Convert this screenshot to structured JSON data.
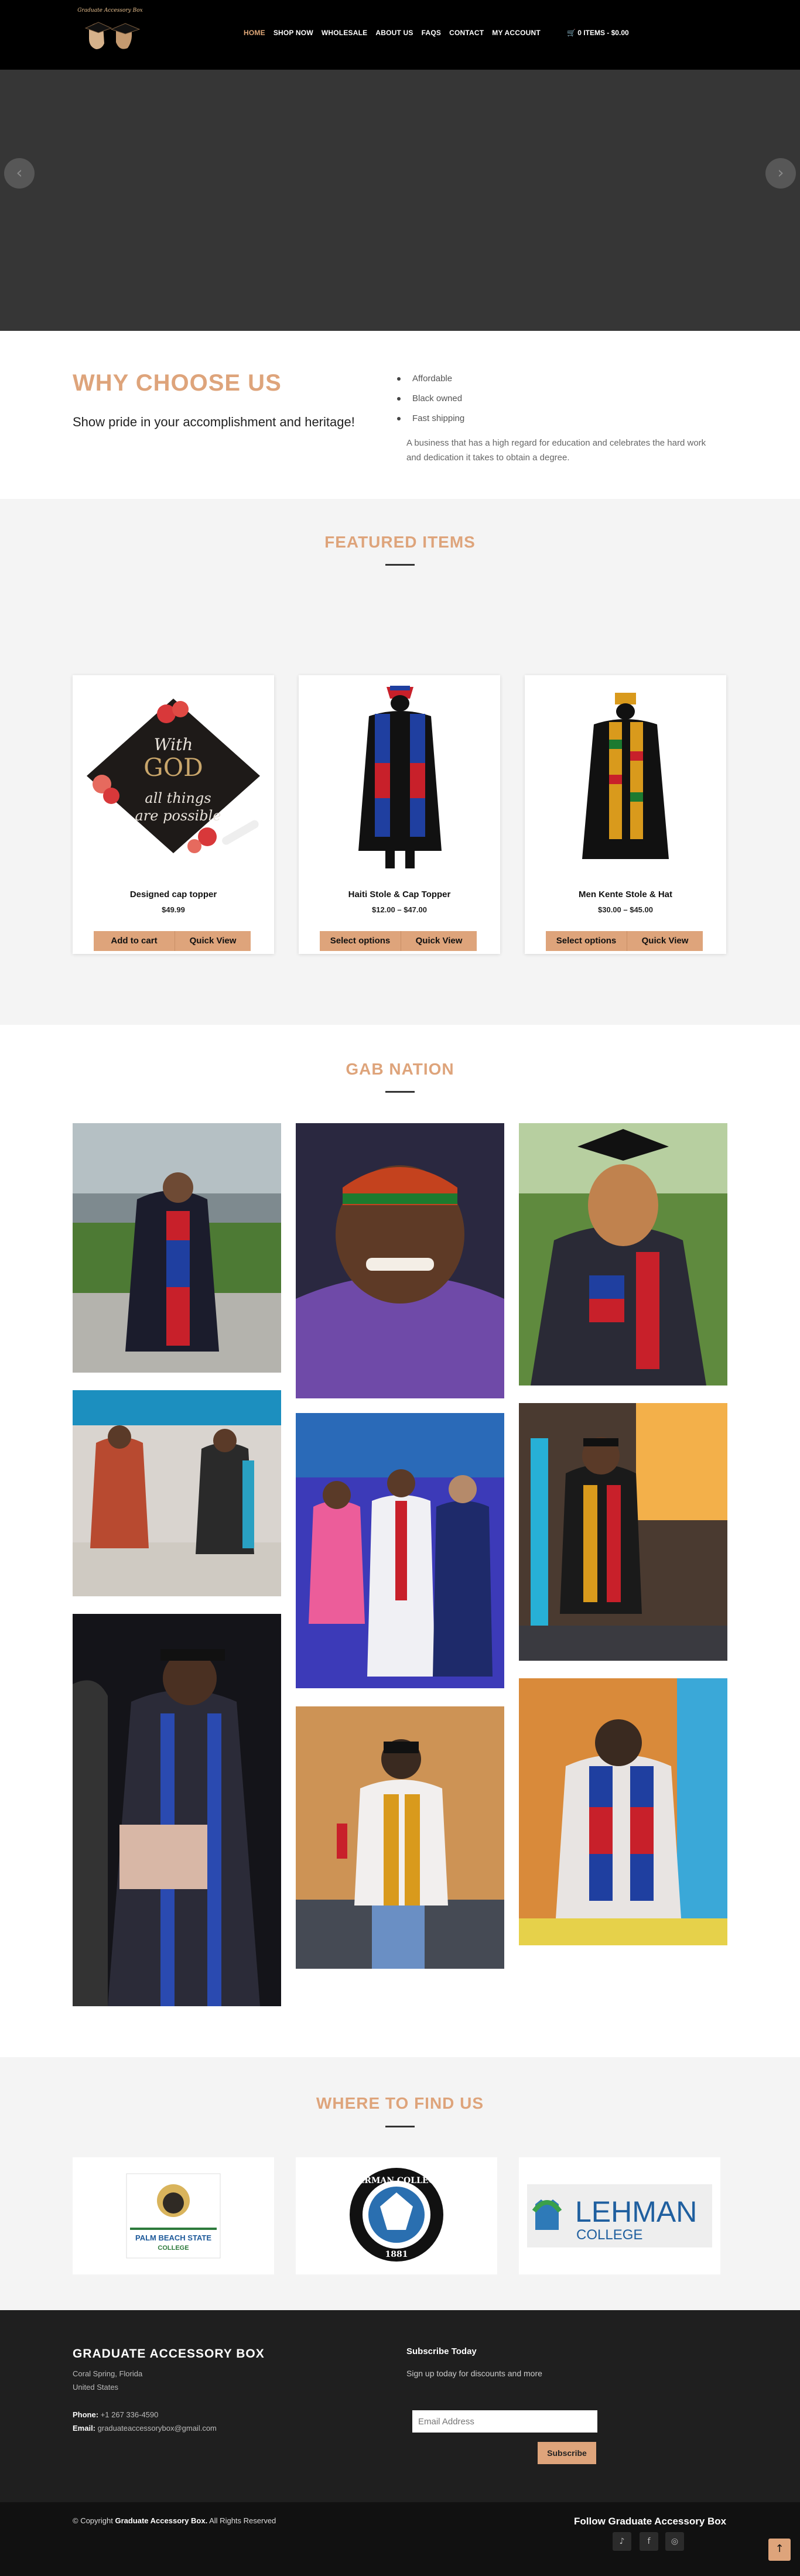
{
  "header": {
    "logo_text": "Graduate Accessory Box",
    "nav": [
      "HOME",
      "SHOP NOW",
      "WHOLESALE",
      "ABOUT US",
      "FAQS",
      "CONTACT",
      "MY ACCOUNT"
    ],
    "cart": "0 ITEMS - $0.00"
  },
  "hero": {
    "prev_icon": "‹",
    "next_icon": "›"
  },
  "why": {
    "title": "WHY CHOOSE US",
    "subtitle": "Show pride in your accomplishment and heritage!",
    "list": [
      "Affordable",
      "Black owned",
      "Fast shipping"
    ],
    "description": "A business that has a high regard for education and celebrates the hard work and dedication it takes to obtain a degree."
  },
  "featured": {
    "title": "FEATURED ITEMS",
    "products": [
      {
        "name": "Designed cap topper",
        "price": "$49.99",
        "btn1": "Add to cart",
        "btn2": "Quick View",
        "cap_text1": "With",
        "cap_text2": "GOD",
        "cap_text3": "all things",
        "cap_text4": "are possible"
      },
      {
        "name": "Haiti Stole & Cap Topper",
        "price": "$12.00 – $47.00",
        "btn1": "Select options",
        "btn2": "Quick View"
      },
      {
        "name": "Men Kente Stole & Hat",
        "price": "$30.00 – $45.00",
        "btn1": "Select options",
        "btn2": "Quick View"
      }
    ]
  },
  "gab": {
    "title": "GAB NATION"
  },
  "find": {
    "title": "WHERE TO FIND US",
    "logos": [
      {
        "name": "PALM BEACH STATE",
        "sub": "COLLEGE"
      },
      {
        "name": "BERMAN COLLEGE",
        "year": "1881"
      },
      {
        "name": "LEHMAN",
        "sub": "COLLEGE"
      }
    ]
  },
  "footer": {
    "title": "GRADUATE ACCESSORY BOX",
    "city": "Coral Spring, Florida",
    "country": "United States",
    "phone_label": "Phone:",
    "phone": "+1 267 336-4590",
    "email_label": "Email:",
    "email": "graduateaccessorybox@gmail.com",
    "subscribe_title": "Subscribe Today",
    "subscribe_text": "Sign up today for discounts and more",
    "email_placeholder": "Email Address",
    "subscribe_button": "Subscribe",
    "copyright_prefix": "© Copyright",
    "copyright_brand": "Graduate Accessory Box.",
    "copyright_suffix": "All Rights Reserved",
    "follow": "Follow Graduate Accessory Box",
    "social": [
      "tiktok-icon",
      "facebook-icon",
      "instagram-icon"
    ]
  },
  "colors": {
    "accent": "#dea47b",
    "dark": "#1f1f1f",
    "black": "#000000"
  }
}
